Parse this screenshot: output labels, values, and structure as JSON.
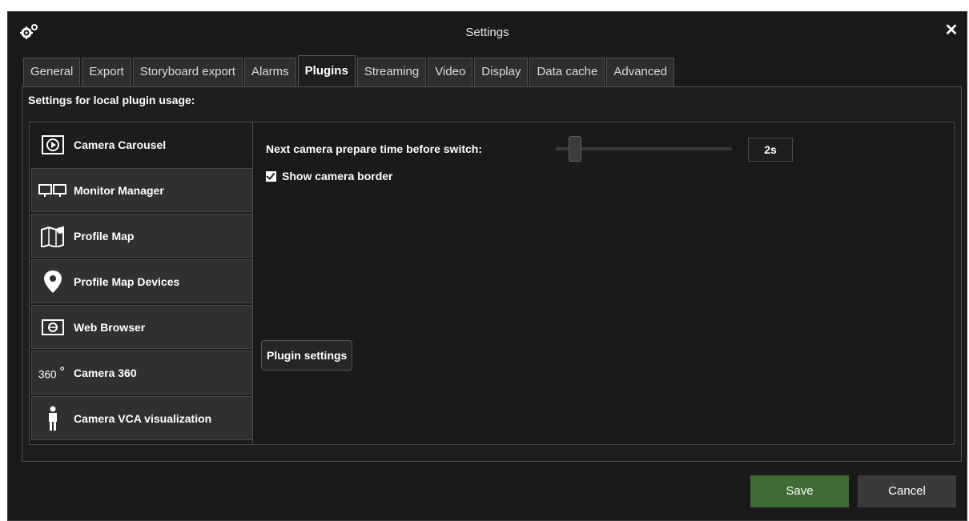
{
  "window": {
    "title": "Settings",
    "close_glyph": "✕",
    "app_icon": "gears-icon"
  },
  "tabs": [
    {
      "label": "General",
      "active": false
    },
    {
      "label": "Export",
      "active": false
    },
    {
      "label": "Storyboard export",
      "active": false
    },
    {
      "label": "Alarms",
      "active": false
    },
    {
      "label": "Plugins",
      "active": true
    },
    {
      "label": "Streaming",
      "active": false
    },
    {
      "label": "Video",
      "active": false
    },
    {
      "label": "Display",
      "active": false
    },
    {
      "label": "Data cache",
      "active": false
    },
    {
      "label": "Advanced",
      "active": false
    }
  ],
  "panel": {
    "label": "Settings for local plugin usage:"
  },
  "plugins": [
    {
      "label": "Camera Carousel",
      "icon": "camera-carousel-icon",
      "active": true
    },
    {
      "label": "Monitor Manager",
      "icon": "monitor-manager-icon",
      "active": false
    },
    {
      "label": "Profile Map",
      "icon": "profile-map-icon",
      "active": false
    },
    {
      "label": "Profile Map Devices",
      "icon": "map-pin-icon",
      "active": false
    },
    {
      "label": "Web Browser",
      "icon": "web-browser-icon",
      "active": false
    },
    {
      "label": "Camera 360",
      "icon": "camera-360-icon",
      "active": false
    },
    {
      "label": "Camera VCA visualization",
      "icon": "person-icon",
      "active": false
    }
  ],
  "content": {
    "prepare_time_label": "Next camera prepare time before switch:",
    "prepare_time_value": "2s",
    "slider_position": 0.08,
    "show_border_label": "Show camera border",
    "show_border_checked": true,
    "plugin_settings_label": "Plugin settings"
  },
  "footer": {
    "save_label": "Save",
    "cancel_label": "Cancel"
  },
  "colors": {
    "save_bg": "#3f6b35",
    "window_bg": "#1a1a1a"
  }
}
